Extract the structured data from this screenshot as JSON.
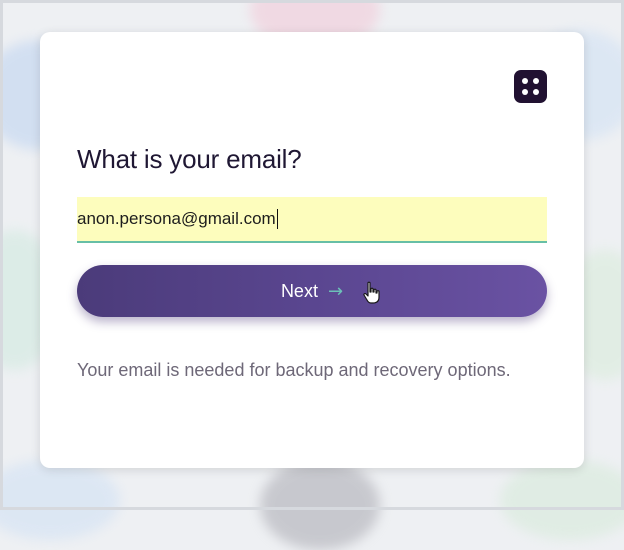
{
  "dialog": {
    "title": "What is your email?",
    "email_value": "anon.persona@gmail.com",
    "next_label": "Next",
    "helper_text": "Your email is needed for backup and recovery options."
  },
  "icons": {
    "logo": "logo-icon",
    "arrow": "arrow-right-icon",
    "cursor": "hand-pointer-icon"
  },
  "colors": {
    "button_gradient_start": "#4b3b7a",
    "button_gradient_end": "#6a52a3",
    "field_background": "#fdfdbd",
    "field_underline": "#67bfa6",
    "arrow_accent": "#6cc0b8",
    "logo_background": "#211131"
  }
}
